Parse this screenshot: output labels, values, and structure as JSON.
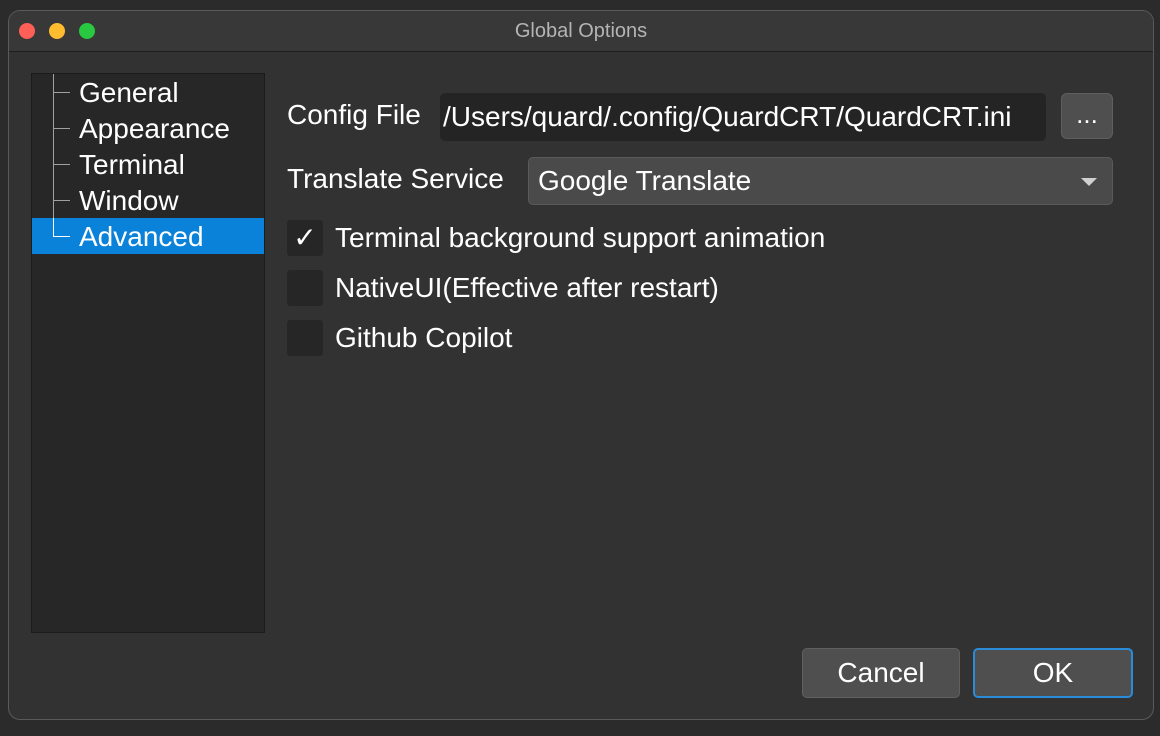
{
  "window": {
    "title": "Global Options"
  },
  "sidebar": {
    "items": [
      {
        "label": "General",
        "selected": false
      },
      {
        "label": "Appearance",
        "selected": false
      },
      {
        "label": "Terminal",
        "selected": false
      },
      {
        "label": "Window",
        "selected": false
      },
      {
        "label": "Advanced",
        "selected": true
      }
    ]
  },
  "form": {
    "config_file_label": "Config File",
    "config_file_value": "/Users/quard/.config/QuardCRT/QuardCRT.ini",
    "browse_label": "...",
    "translate_label": "Translate Service",
    "translate_value": "Google Translate",
    "checkboxes": [
      {
        "label": "Terminal background support animation",
        "checked": true,
        "mark": "✓"
      },
      {
        "label": "NativeUI(Effective after restart)",
        "checked": false,
        "mark": ""
      },
      {
        "label": "Github Copilot",
        "checked": false,
        "mark": ""
      }
    ]
  },
  "buttons": {
    "cancel_label": "Cancel",
    "ok_label": "OK"
  },
  "colors": {
    "selection": "#0a82d9",
    "ok_border": "#2a8cd9",
    "close": "#fe5f57",
    "minimize": "#febc2e",
    "maximize": "#28c840"
  }
}
